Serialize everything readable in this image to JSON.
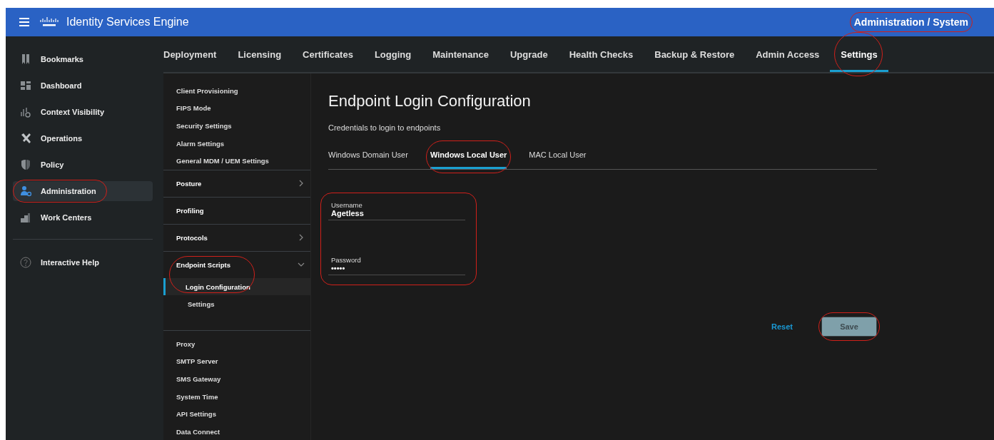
{
  "header": {
    "brand": "Identity Services Engine",
    "breadcrumb": {
      "text": "Administration / System",
      "annotated": true
    }
  },
  "sidebar": {
    "items": [
      {
        "label": "Bookmarks",
        "selected": false,
        "annotated": false
      },
      {
        "label": "Dashboard",
        "selected": false,
        "annotated": false
      },
      {
        "label": "Context Visibility",
        "selected": false,
        "annotated": false
      },
      {
        "label": "Operations",
        "selected": false,
        "annotated": false
      },
      {
        "label": "Policy",
        "selected": false,
        "annotated": false
      },
      {
        "label": "Administration",
        "selected": true,
        "annotated": true
      },
      {
        "label": "Work Centers",
        "selected": false,
        "annotated": false
      }
    ],
    "help": "Interactive Help"
  },
  "tabs": [
    {
      "label": "Deployment",
      "selected": false,
      "annotated": false
    },
    {
      "label": "Licensing",
      "selected": false,
      "annotated": false
    },
    {
      "label": "Certificates",
      "selected": false,
      "annotated": false
    },
    {
      "label": "Logging",
      "selected": false,
      "annotated": false
    },
    {
      "label": "Maintenance",
      "selected": false,
      "annotated": false
    },
    {
      "label": "Upgrade",
      "selected": false,
      "annotated": false
    },
    {
      "label": "Health Checks",
      "selected": false,
      "annotated": false
    },
    {
      "label": "Backup & Restore",
      "selected": false,
      "annotated": false
    },
    {
      "label": "Admin Access",
      "selected": false,
      "annotated": false
    },
    {
      "label": "Settings",
      "selected": true,
      "annotated": true
    }
  ],
  "subnav": {
    "sections": [
      {
        "kind": "list",
        "items": [
          {
            "label": "Client Provisioning"
          },
          {
            "label": "FIPS Mode"
          },
          {
            "label": "Security Settings"
          },
          {
            "label": "Alarm Settings"
          },
          {
            "label": "General MDM / UEM Settings"
          }
        ]
      },
      {
        "kind": "group",
        "label": "Posture",
        "expanded": false,
        "annotated": false
      },
      {
        "kind": "plain",
        "label": "Profiling"
      },
      {
        "kind": "group",
        "label": "Protocols",
        "expanded": false,
        "annotated": false
      },
      {
        "kind": "group",
        "label": "Endpoint Scripts",
        "expanded": true,
        "annotated": true,
        "children": [
          {
            "label": "Login Configuration",
            "selected": true
          },
          {
            "label": "Settings",
            "selected": false
          }
        ]
      },
      {
        "kind": "list",
        "items": [
          {
            "label": "Proxy"
          },
          {
            "label": "SMTP Server"
          },
          {
            "label": "SMS Gateway"
          },
          {
            "label": "System Time"
          },
          {
            "label": "API Settings"
          },
          {
            "label": "Data Connect"
          }
        ]
      }
    ]
  },
  "content": {
    "title": "Endpoint Login Configuration",
    "subtitle": "Credentials to login to endpoints",
    "tabs": [
      {
        "label": "Windows Domain User",
        "selected": false,
        "annotated": false
      },
      {
        "label": "Windows Local User",
        "selected": true,
        "annotated": true
      },
      {
        "label": "MAC Local User",
        "selected": false,
        "annotated": false
      }
    ],
    "fields_annotated": true,
    "fields": [
      {
        "label": "Username",
        "value": "Agetless"
      },
      {
        "label": "Password",
        "value": "•••••"
      }
    ],
    "reset": "Reset",
    "save": {
      "label": "Save",
      "annotated": true
    }
  }
}
